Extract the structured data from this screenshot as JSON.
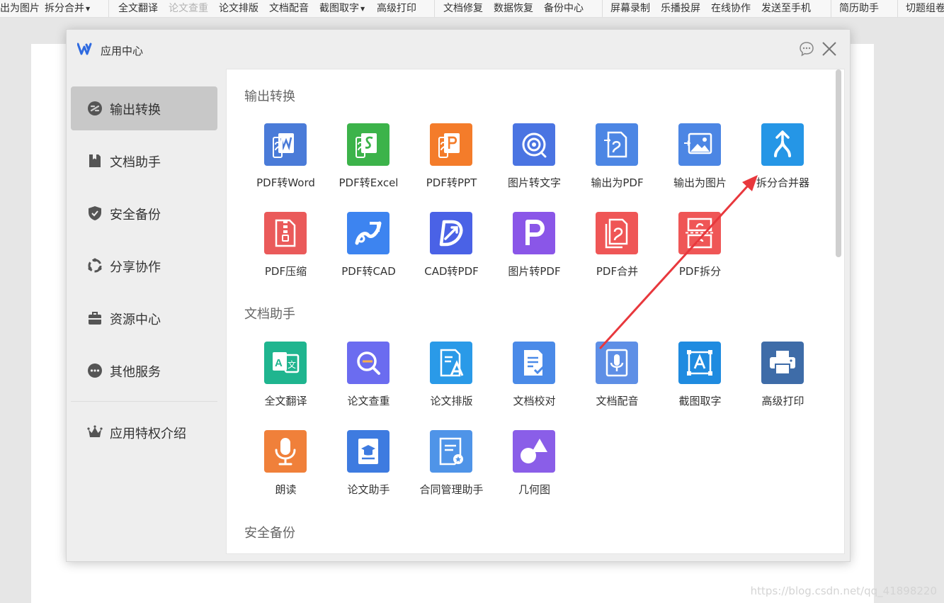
{
  "toolbar": {
    "items": [
      {
        "label": "出为图片"
      },
      {
        "label": "拆分合并"
      },
      {
        "label": "全文翻译"
      },
      {
        "label": "论文查重"
      },
      {
        "label": "论文排版"
      },
      {
        "label": "文档配音"
      },
      {
        "label": "截图取字"
      },
      {
        "label": "高级打印"
      },
      {
        "label": "文档修复"
      },
      {
        "label": "数据恢复"
      },
      {
        "label": "备份中心"
      },
      {
        "label": "屏幕录制"
      },
      {
        "label": "乐播投屏"
      },
      {
        "label": "在线协作"
      },
      {
        "label": "发送至手机"
      },
      {
        "label": "简历助手"
      },
      {
        "label": "切题组卷"
      }
    ]
  },
  "dialog": {
    "title": "应用中心",
    "logo_icon": "wps-logo-icon",
    "chat_icon": "chat-icon",
    "close_icon": "close-icon"
  },
  "sidebar": {
    "items": [
      {
        "label": "输出转换",
        "icon": "convert-icon",
        "active": true
      },
      {
        "label": "文档助手",
        "icon": "document-icon",
        "active": false
      },
      {
        "label": "安全备份",
        "icon": "shield-icon",
        "active": false
      },
      {
        "label": "分享协作",
        "icon": "share-icon",
        "active": false
      },
      {
        "label": "资源中心",
        "icon": "briefcase-icon",
        "active": false
      },
      {
        "label": "其他服务",
        "icon": "more-icon",
        "active": false
      }
    ],
    "footer_label": "应用特权介绍",
    "footer_icon": "crown-icon"
  },
  "sections": [
    {
      "title": "输出转换",
      "apps": [
        {
          "label": "PDF转Word",
          "color": "#4a7bd8",
          "icon": "pdf-to-word-icon"
        },
        {
          "label": "PDF转Excel",
          "color": "#3cb34a",
          "icon": "pdf-to-excel-icon"
        },
        {
          "label": "PDF转PPT",
          "color": "#f47c2a",
          "icon": "pdf-to-ppt-icon"
        },
        {
          "label": "图片转文字",
          "color": "#4a74e2",
          "icon": "image-to-text-icon"
        },
        {
          "label": "输出为PDF",
          "color": "#4c86e4",
          "icon": "export-pdf-icon"
        },
        {
          "label": "输出为图片",
          "color": "#4c86e4",
          "icon": "export-image-icon"
        },
        {
          "label": "拆分合并器",
          "color": "#2596e6",
          "icon": "split-merge-icon"
        },
        {
          "label": "PDF压缩",
          "color": "#ea5a5a",
          "icon": "pdf-compress-icon"
        },
        {
          "label": "PDF转CAD",
          "color": "#3d84f0",
          "icon": "pdf-to-cad-icon"
        },
        {
          "label": "CAD转PDF",
          "color": "#4a62e6",
          "icon": "cad-to-pdf-icon"
        },
        {
          "label": "图片转PDF",
          "color": "#8a56e8",
          "icon": "image-to-pdf-icon"
        },
        {
          "label": "PDF合并",
          "color": "#ef5656",
          "icon": "pdf-merge-icon"
        },
        {
          "label": "PDF拆分",
          "color": "#ef5656",
          "icon": "pdf-split-icon"
        }
      ]
    },
    {
      "title": "文档助手",
      "apps": [
        {
          "label": "全文翻译",
          "color": "#1fb58f",
          "icon": "translate-icon"
        },
        {
          "label": "论文查重",
          "color": "#6b6cf0",
          "icon": "thesis-check-icon"
        },
        {
          "label": "论文排版",
          "color": "#2a9ae8",
          "icon": "thesis-layout-icon"
        },
        {
          "label": "文档校对",
          "color": "#4a8ae8",
          "icon": "proofread-icon"
        },
        {
          "label": "文档配音",
          "color": "#5e8fe6",
          "icon": "voiceover-icon"
        },
        {
          "label": "截图取字",
          "color": "#1f8be0",
          "icon": "screenshot-ocr-icon"
        },
        {
          "label": "高级打印",
          "color": "#3e6ca8",
          "icon": "print-icon"
        },
        {
          "label": "朗读",
          "color": "#f0803a",
          "icon": "microphone-icon"
        },
        {
          "label": "论文助手",
          "color": "#3e7be0",
          "icon": "thesis-assistant-icon"
        },
        {
          "label": "合同管理助手",
          "color": "#4f94e8",
          "icon": "contract-icon"
        },
        {
          "label": "几何图",
          "color": "#8a5ee8",
          "icon": "geometry-icon"
        }
      ]
    },
    {
      "title": "安全备份",
      "apps": []
    }
  ],
  "annotation": {
    "icon": "red-arrow-icon",
    "color": "#e8383d"
  },
  "watermark": "https://blog.csdn.net/qq_41898220"
}
